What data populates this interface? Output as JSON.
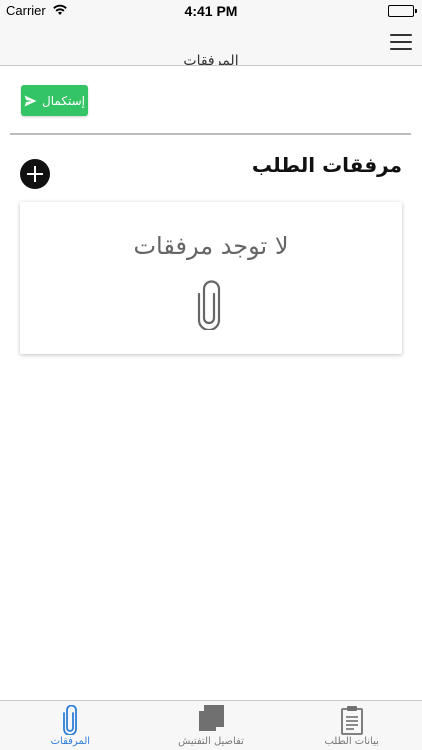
{
  "status_bar": {
    "carrier": "Carrier",
    "time": "4:41 PM"
  },
  "nav_bar": {
    "title": "المرفقات"
  },
  "toolbar": {
    "submit_label": "إستكمال",
    "submit_color": "#33c466"
  },
  "section": {
    "title": "مرفقات الطلب"
  },
  "empty_state": {
    "message": "لا توجد مرفقات",
    "icon": "paperclip-icon"
  },
  "tab_bar": {
    "active_color": "#2f7ed8",
    "tabs": [
      {
        "label": "المرفقات",
        "icon": "paperclip-icon",
        "active": true
      },
      {
        "label": "تفاصيل التفتيش",
        "icon": "copy-icon",
        "active": false
      },
      {
        "label": "بيانات الطلب",
        "icon": "clipboard-icon",
        "active": false
      }
    ]
  }
}
